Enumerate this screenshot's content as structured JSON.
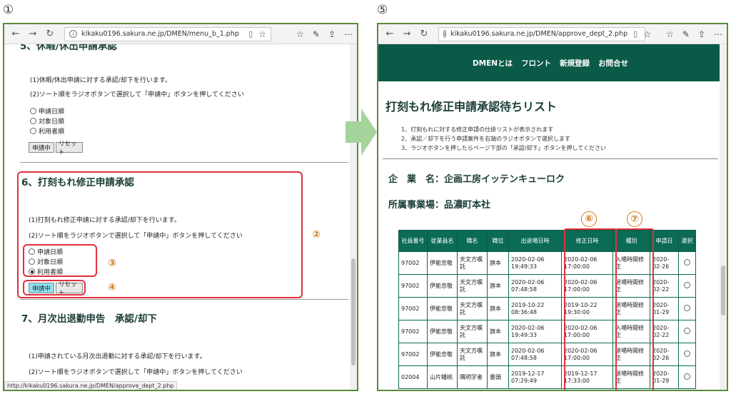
{
  "markers": {
    "left": "①",
    "right": "⑤"
  },
  "left": {
    "url": "kikaku0196.sakura.ne.jp/DMEN/menu_b_1.php",
    "section5_heading_partial": "5、休暇/休出申請承認",
    "s5_line1": "(1)休暇/休出申請に対する承認/却下を行います。",
    "s5_line2": "(2)ソート順をラジオボタンで選択して「申請中」ボタンを押してください",
    "radio_labels": [
      "申請日順",
      "対象日順",
      "利用者順"
    ],
    "btn_apply": "申請中",
    "btn_reset": "リセット",
    "section6_heading": "6、打刻もれ修正申請承認",
    "s6_line1": "(1)打刻もれ修正申請に対する承認/却下を行います。",
    "s6_line2": "(2)ソート順をラジオボタンで選択して「申請中」ボタンを押してください",
    "section7_heading": "7、月次出退勤申告　承認/却下",
    "s7_line1": "(1)申請されている月次出退勤に対する承認/却下を行います。",
    "s7_line2": "(2)ソート順をラジオボタンで選択して「申請中」ボタンを押してください",
    "status_url": "http://kikaku0196.sakura.ne.jp/DMEN/approve_dept_2.php",
    "callouts": {
      "c2": "②",
      "c3": "③",
      "c4": "④"
    }
  },
  "right": {
    "url": "kikaku0196.sakura.ne.jp/DMEN/approve_dept_2.php",
    "nav": [
      "DMENとは",
      "フロント",
      "新規登録",
      "お問合せ"
    ],
    "title": "打刻もれ修正申請承認待ちリスト",
    "notes": [
      "1、打刻もれに対する修正申請の仕掛リストが表示されます",
      "2、承認／却下を行う申請案件を右端のラジオボタンで選択します",
      "3、ラジオボタンを押したらページ下部の「承認/却下」ボタンを押してください"
    ],
    "company_label": "企　業　名：",
    "company_value": "企画工房イッテンキューロク",
    "office_label": "所属事業場：",
    "office_value": "品濃町本社",
    "callouts": {
      "c6": "⑥",
      "c7": "⑦"
    },
    "table": {
      "headers": [
        "社員番号",
        "従業員名",
        "職名",
        "職位",
        "出退場日時",
        "修正日時",
        "種別",
        "申請日",
        "選択"
      ],
      "rows": [
        [
          "97002",
          "伊能忠敬",
          "天文方嘱託",
          "旗本",
          "2020-02-06 19:49:33",
          "2020-02-06 17:00:00",
          "入場時間修正",
          "2020-02-26"
        ],
        [
          "97002",
          "伊能忠敬",
          "天文方嘱託",
          "旗本",
          "2020-02-06 07:48:58",
          "2020-02-06 17:00:00",
          "退場時間修正",
          "2020-02-22"
        ],
        [
          "97002",
          "伊能忠敬",
          "天文方嘱託",
          "旗本",
          "2019-10-22 08:36:48",
          "2019-10-22 19:30:00",
          "退場時間修正",
          "2020-01-29"
        ],
        [
          "97002",
          "伊能忠敬",
          "天文方嘱託",
          "旗本",
          "2020-02-06 19:49:33",
          "2020-02-06 17:00:00",
          "入場時間修正",
          "2020-02-22"
        ],
        [
          "97002",
          "伊能忠敬",
          "天文方嘱託",
          "旗本",
          "2020-02-06 07:48:58",
          "2020-02-06 17:00:00",
          "退場時間修正",
          "2020-02-26"
        ],
        [
          "02004",
          "山片蟠桃",
          "隅明学者",
          "番頭",
          "2019-12-17 07:29:49",
          "2019-12-17 17:33:00",
          "退場時間修正",
          "2020-01-29"
        ]
      ]
    }
  },
  "colors": {
    "frame": "#5a8a3a",
    "banner": "#0b5a48",
    "table_header": "#0b6b55",
    "callout_box": "#e0303c",
    "callout_number": "#d07a1a"
  }
}
